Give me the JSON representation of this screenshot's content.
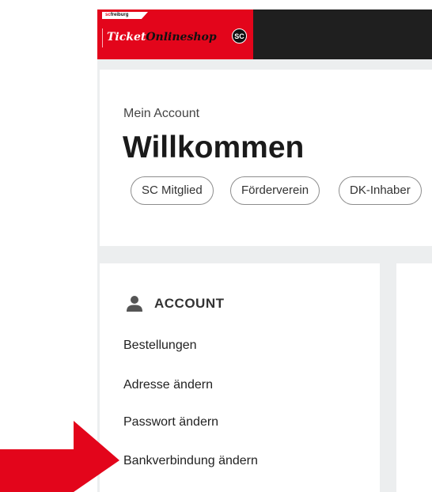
{
  "header": {
    "brand_top": "freiburg",
    "brand_sc": "sc",
    "brand_ticket": "Ticket",
    "brand_online": "Onlineshop",
    "badge_glyph": "SC",
    "colors": {
      "brand_red": "#e3051b",
      "bar": "#1f1f1f"
    }
  },
  "account": {
    "subtitle": "Mein Account",
    "title": "Willkommen",
    "badges": [
      "SC Mitglied",
      "Förderverein",
      "DK-Inhaber"
    ]
  },
  "sidebar": {
    "heading": "ACCOUNT",
    "heading_icon": "user-icon",
    "items": [
      {
        "label": "Bestellungen"
      },
      {
        "label": "Adresse ändern"
      },
      {
        "label": "Passwort ändern"
      },
      {
        "label": "Bankverbindung ändern"
      }
    ]
  },
  "annotation": {
    "arrow_icon": "red-arrow-icon",
    "color": "#e3051b"
  }
}
